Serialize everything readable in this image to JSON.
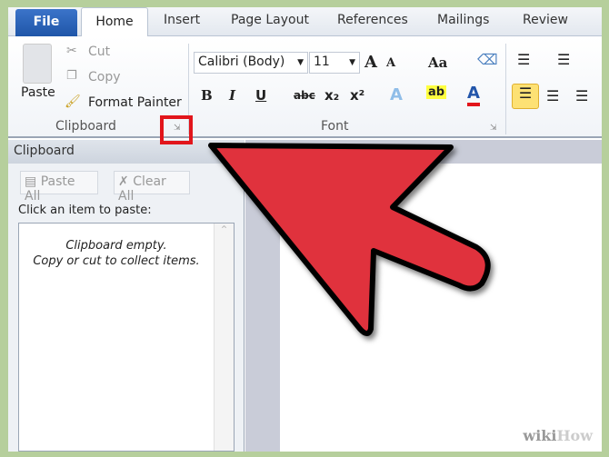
{
  "tabs": {
    "file": "File",
    "home": "Home",
    "insert": "Insert",
    "page_layout": "Page Layout",
    "references": "References",
    "mailings": "Mailings",
    "review": "Review"
  },
  "clipboard_group": {
    "paste": "Paste",
    "cut": "Cut",
    "copy": "Copy",
    "format_painter": "Format Painter",
    "label": "Clipboard"
  },
  "font_group": {
    "font_name": "Calibri (Body)",
    "font_size": "11",
    "label": "Font",
    "bold": "B",
    "italic": "I",
    "underline": "U",
    "strike": "abc",
    "sub": "x₂",
    "sup": "x²",
    "grow": "A",
    "shrink": "A",
    "change_case": "Aa",
    "text_effects": "A",
    "highlight": "ab",
    "font_color": "A"
  },
  "pane": {
    "title": "Clipboard",
    "paste_all": "Paste All",
    "clear_all": "Clear All",
    "instruction": "Click an item to paste:",
    "empty_line1": "Clipboard empty.",
    "empty_line2": "Copy or cut to collect items."
  },
  "watermark": {
    "wiki": "wiki",
    "how": "How"
  },
  "colors": {
    "arrow": "#e0303c",
    "highlight_box": "#e2151b",
    "background": "#b6cf9c",
    "file_tab": "#2a62b8"
  }
}
